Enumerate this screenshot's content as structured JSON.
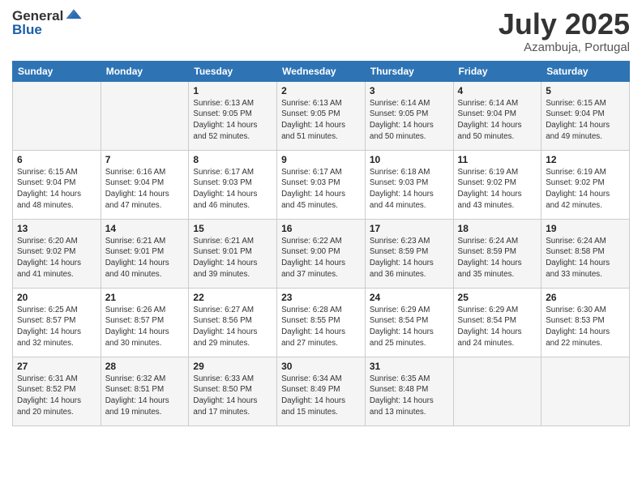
{
  "logo": {
    "general": "General",
    "blue": "Blue"
  },
  "title": "July 2025",
  "subtitle": "Azambuja, Portugal",
  "days_header": [
    "Sunday",
    "Monday",
    "Tuesday",
    "Wednesday",
    "Thursday",
    "Friday",
    "Saturday"
  ],
  "weeks": [
    [
      {
        "day": "",
        "info": ""
      },
      {
        "day": "",
        "info": ""
      },
      {
        "day": "1",
        "info": "Sunrise: 6:13 AM\nSunset: 9:05 PM\nDaylight: 14 hours and 52 minutes."
      },
      {
        "day": "2",
        "info": "Sunrise: 6:13 AM\nSunset: 9:05 PM\nDaylight: 14 hours and 51 minutes."
      },
      {
        "day": "3",
        "info": "Sunrise: 6:14 AM\nSunset: 9:05 PM\nDaylight: 14 hours and 50 minutes."
      },
      {
        "day": "4",
        "info": "Sunrise: 6:14 AM\nSunset: 9:04 PM\nDaylight: 14 hours and 50 minutes."
      },
      {
        "day": "5",
        "info": "Sunrise: 6:15 AM\nSunset: 9:04 PM\nDaylight: 14 hours and 49 minutes."
      }
    ],
    [
      {
        "day": "6",
        "info": "Sunrise: 6:15 AM\nSunset: 9:04 PM\nDaylight: 14 hours and 48 minutes."
      },
      {
        "day": "7",
        "info": "Sunrise: 6:16 AM\nSunset: 9:04 PM\nDaylight: 14 hours and 47 minutes."
      },
      {
        "day": "8",
        "info": "Sunrise: 6:17 AM\nSunset: 9:03 PM\nDaylight: 14 hours and 46 minutes."
      },
      {
        "day": "9",
        "info": "Sunrise: 6:17 AM\nSunset: 9:03 PM\nDaylight: 14 hours and 45 minutes."
      },
      {
        "day": "10",
        "info": "Sunrise: 6:18 AM\nSunset: 9:03 PM\nDaylight: 14 hours and 44 minutes."
      },
      {
        "day": "11",
        "info": "Sunrise: 6:19 AM\nSunset: 9:02 PM\nDaylight: 14 hours and 43 minutes."
      },
      {
        "day": "12",
        "info": "Sunrise: 6:19 AM\nSunset: 9:02 PM\nDaylight: 14 hours and 42 minutes."
      }
    ],
    [
      {
        "day": "13",
        "info": "Sunrise: 6:20 AM\nSunset: 9:02 PM\nDaylight: 14 hours and 41 minutes."
      },
      {
        "day": "14",
        "info": "Sunrise: 6:21 AM\nSunset: 9:01 PM\nDaylight: 14 hours and 40 minutes."
      },
      {
        "day": "15",
        "info": "Sunrise: 6:21 AM\nSunset: 9:01 PM\nDaylight: 14 hours and 39 minutes."
      },
      {
        "day": "16",
        "info": "Sunrise: 6:22 AM\nSunset: 9:00 PM\nDaylight: 14 hours and 37 minutes."
      },
      {
        "day": "17",
        "info": "Sunrise: 6:23 AM\nSunset: 8:59 PM\nDaylight: 14 hours and 36 minutes."
      },
      {
        "day": "18",
        "info": "Sunrise: 6:24 AM\nSunset: 8:59 PM\nDaylight: 14 hours and 35 minutes."
      },
      {
        "day": "19",
        "info": "Sunrise: 6:24 AM\nSunset: 8:58 PM\nDaylight: 14 hours and 33 minutes."
      }
    ],
    [
      {
        "day": "20",
        "info": "Sunrise: 6:25 AM\nSunset: 8:57 PM\nDaylight: 14 hours and 32 minutes."
      },
      {
        "day": "21",
        "info": "Sunrise: 6:26 AM\nSunset: 8:57 PM\nDaylight: 14 hours and 30 minutes."
      },
      {
        "day": "22",
        "info": "Sunrise: 6:27 AM\nSunset: 8:56 PM\nDaylight: 14 hours and 29 minutes."
      },
      {
        "day": "23",
        "info": "Sunrise: 6:28 AM\nSunset: 8:55 PM\nDaylight: 14 hours and 27 minutes."
      },
      {
        "day": "24",
        "info": "Sunrise: 6:29 AM\nSunset: 8:54 PM\nDaylight: 14 hours and 25 minutes."
      },
      {
        "day": "25",
        "info": "Sunrise: 6:29 AM\nSunset: 8:54 PM\nDaylight: 14 hours and 24 minutes."
      },
      {
        "day": "26",
        "info": "Sunrise: 6:30 AM\nSunset: 8:53 PM\nDaylight: 14 hours and 22 minutes."
      }
    ],
    [
      {
        "day": "27",
        "info": "Sunrise: 6:31 AM\nSunset: 8:52 PM\nDaylight: 14 hours and 20 minutes."
      },
      {
        "day": "28",
        "info": "Sunrise: 6:32 AM\nSunset: 8:51 PM\nDaylight: 14 hours and 19 minutes."
      },
      {
        "day": "29",
        "info": "Sunrise: 6:33 AM\nSunset: 8:50 PM\nDaylight: 14 hours and 17 minutes."
      },
      {
        "day": "30",
        "info": "Sunrise: 6:34 AM\nSunset: 8:49 PM\nDaylight: 14 hours and 15 minutes."
      },
      {
        "day": "31",
        "info": "Sunrise: 6:35 AM\nSunset: 8:48 PM\nDaylight: 14 hours and 13 minutes."
      },
      {
        "day": "",
        "info": ""
      },
      {
        "day": "",
        "info": ""
      }
    ]
  ]
}
